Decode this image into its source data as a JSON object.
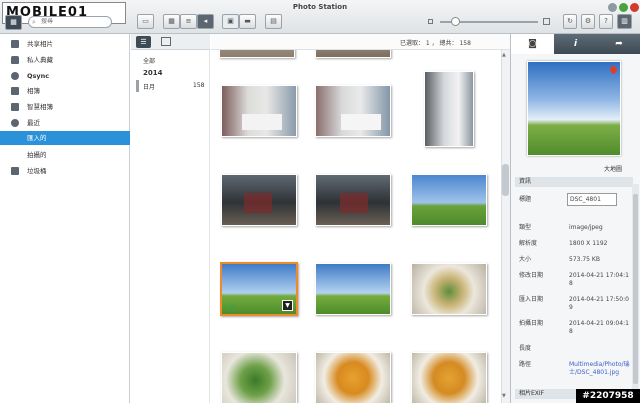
{
  "app": {
    "title": "Photo Station",
    "brand": "MOBILE01",
    "search_placeholder": "搜尋",
    "watermark": "#2207958"
  },
  "sidebar": {
    "items": [
      {
        "label": "共享相片",
        "icon": "folder-icon"
      },
      {
        "label": "私人典藏",
        "icon": "lock-icon"
      },
      {
        "label": "Qsync",
        "icon": "sync-icon"
      },
      {
        "label": "相簿",
        "icon": "album-icon"
      },
      {
        "label": "智慧相簿",
        "icon": "smart-album-icon"
      },
      {
        "label": "最近",
        "icon": "clock-icon"
      },
      {
        "label": "匯入的",
        "icon": ""
      },
      {
        "label": "拍攝的",
        "icon": ""
      },
      {
        "label": "垃圾桶",
        "icon": "trash-icon"
      }
    ],
    "active_index": 6
  },
  "datecol": {
    "all": "全部",
    "year": "2014",
    "month": "日月",
    "count": "158"
  },
  "gridhead": {
    "selected": "已選取： 1 ， 總共： 158"
  },
  "right": {
    "map_label": "大地圖",
    "info_section": "資訊",
    "exif_section": "相片EXIF",
    "info": [
      {
        "k": "標題",
        "v": "DSC_4801"
      },
      {
        "k": "類型",
        "v": "image/jpeg"
      },
      {
        "k": "解析度",
        "v": "1800 X 1192"
      },
      {
        "k": "大小",
        "v": "573.75 KB"
      },
      {
        "k": "修改日期",
        "v": "2014-04-21 17:04:18"
      },
      {
        "k": "匯入日期",
        "v": "2014-04-21 17:50:09"
      },
      {
        "k": "拍攝日期",
        "v": "2014-04-21 09:04:18"
      },
      {
        "k": "長度",
        "v": ""
      },
      {
        "k": "路徑",
        "v": "Multimedia/Photo/瑞士/DSC_4801.jpg"
      }
    ]
  },
  "colors": {
    "accent": "#2b91d8",
    "selection": "#ef8a2a",
    "link": "#3c5ec8"
  }
}
